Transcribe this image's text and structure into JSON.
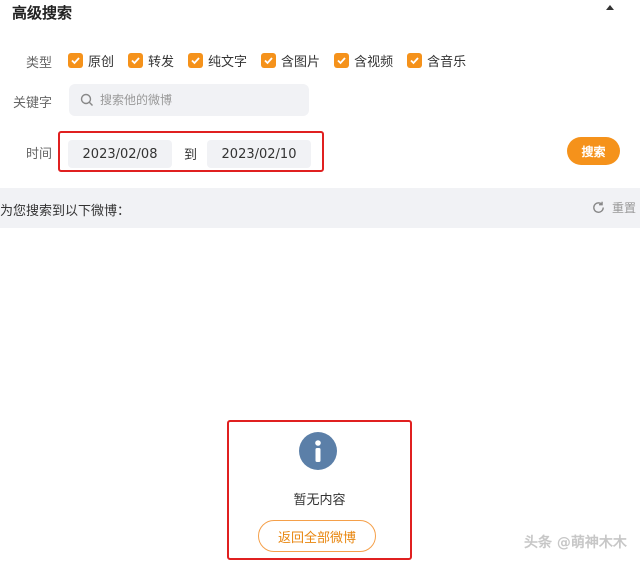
{
  "header": {
    "title": "高级搜索"
  },
  "filters": {
    "type_label": "类型",
    "types": [
      {
        "label": "原创",
        "checked": true
      },
      {
        "label": "转发",
        "checked": true
      },
      {
        "label": "纯文字",
        "checked": true
      },
      {
        "label": "含图片",
        "checked": true
      },
      {
        "label": "含视频",
        "checked": true
      },
      {
        "label": "含音乐",
        "checked": true
      }
    ],
    "keyword_label": "关键字",
    "keyword_placeholder": "搜索他的微博",
    "keyword_value": "",
    "time_label": "时间",
    "date_from": "2023/02/08",
    "date_to_word": "到",
    "date_to": "2023/02/10",
    "search_button": "搜索"
  },
  "result": {
    "heading": "为您搜索到以下微博：",
    "reset_label": "重置",
    "empty_text": "暂无内容",
    "back_button": "返回全部微博"
  },
  "watermark": "头条 @萌神木木",
  "colors": {
    "accent": "#f5921b",
    "highlight_border": "#e02020",
    "info_icon": "#5b7fa8",
    "bar_bg": "#f1f2f5"
  }
}
